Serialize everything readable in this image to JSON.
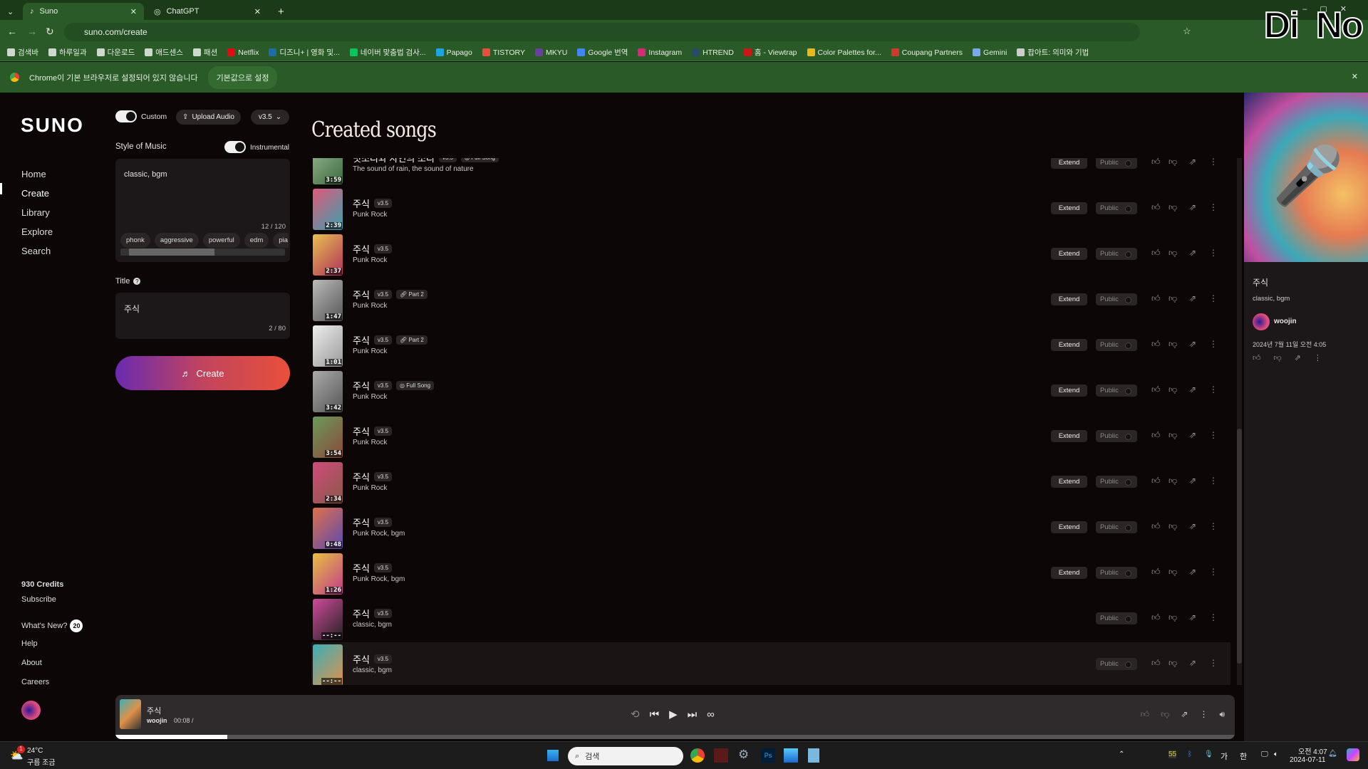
{
  "browser": {
    "tabs": [
      {
        "label": "Suno",
        "active": true
      },
      {
        "label": "ChatGPT",
        "active": false
      }
    ],
    "url": "suno.com/create",
    "bookmarks": [
      {
        "label": "검색바",
        "color": "#cfd8cc"
      },
      {
        "label": "하루일과",
        "color": "#cfd8cc"
      },
      {
        "label": "다운로드",
        "color": "#cfd8cc"
      },
      {
        "label": "애드센스",
        "color": "#cfd8cc"
      },
      {
        "label": "패션",
        "color": "#cfd8cc"
      },
      {
        "label": "Netflix",
        "color": "#e50914"
      },
      {
        "label": "디즈니+ | 영화 및...",
        "color": "#1e6ba8"
      },
      {
        "label": "네이버 맞춤법 검사...",
        "color": "#03c75a"
      },
      {
        "label": "Papago",
        "color": "#1fa4e0"
      },
      {
        "label": "TISTORY",
        "color": "#e84e3c"
      },
      {
        "label": "MKYU",
        "color": "#6a3fa0"
      },
      {
        "label": "Google 번역",
        "color": "#4285f4"
      },
      {
        "label": "Instagram",
        "color": "#d62976"
      },
      {
        "label": "HTREND",
        "color": "#2a4a6a"
      },
      {
        "label": "홈 - Viewtrap",
        "color": "#c81818"
      },
      {
        "label": "Color Palettes for...",
        "color": "#e8b820"
      },
      {
        "label": "Coupang Partners",
        "color": "#d03a2a"
      },
      {
        "label": "Gemini",
        "color": "#7aa8f0"
      },
      {
        "label": "팝아트: 의미와 기법",
        "color": "#cccccc"
      }
    ],
    "infobar": {
      "message": "Chrome이 기본 브라우저로 설정되어 있지 않습니다",
      "button": "기본값으로 설정"
    },
    "overlay_logo": "DiNo"
  },
  "nav": {
    "logo": "SUNO",
    "items": [
      {
        "label": "Home"
      },
      {
        "label": "Create",
        "active": true
      },
      {
        "label": "Library"
      },
      {
        "label": "Explore"
      },
      {
        "label": "Search"
      }
    ],
    "credits": "930 Credits",
    "subscribe": "Subscribe",
    "whats_new": "What's New?",
    "whats_new_count": "20",
    "help": "Help",
    "about": "About",
    "careers": "Careers"
  },
  "create": {
    "custom_label": "Custom",
    "custom_on": true,
    "upload_label": "Upload Audio",
    "version": "v3.5",
    "style_label": "Style of Music",
    "instrumental_label": "Instrumental",
    "instrumental_on": true,
    "style_value": "classic, bgm",
    "style_count": "12 / 120",
    "chips": [
      "phonk",
      "aggressive",
      "powerful",
      "edm",
      "pia"
    ],
    "title_label": "Title",
    "title_value": "주식",
    "title_count": "2 / 80",
    "create_button": "Create"
  },
  "songs": {
    "heading": "Created songs",
    "extend": "Extend",
    "public": "Public",
    "items": [
      {
        "title": "빗소리와 자연의 소리",
        "version": "v3.5",
        "tag": "Full Song",
        "style": "The sound of rain, the sound of nature",
        "duration": "3:59",
        "extend": true,
        "colors": [
          "#9ab890",
          "#3e6a40"
        ]
      },
      {
        "title": "주식",
        "version": "v3.5",
        "tag": "",
        "style": "Punk Rock",
        "duration": "2:39",
        "extend": true,
        "colors": [
          "#e05a7a",
          "#3aa0b0"
        ]
      },
      {
        "title": "주식",
        "version": "v3.5",
        "tag": "",
        "style": "Punk Rock",
        "duration": "2:37",
        "extend": true,
        "colors": [
          "#e8c050",
          "#b0305a"
        ]
      },
      {
        "title": "주식",
        "version": "v3.5",
        "tag": "Part 2",
        "style": "Punk Rock",
        "duration": "1:47",
        "extend": true,
        "colors": [
          "#bbbbbb",
          "#555555"
        ]
      },
      {
        "title": "주식",
        "version": "v3.5",
        "tag": "Part 2",
        "style": "Punk Rock",
        "duration": "1:01",
        "extend": true,
        "colors": [
          "#eeeeee",
          "#999999"
        ]
      },
      {
        "title": "주식",
        "version": "v3.5",
        "tag": "Full Song",
        "style": "Punk Rock",
        "duration": "3:42",
        "extend": true,
        "colors": [
          "#aaaaaa",
          "#555555"
        ]
      },
      {
        "title": "주식",
        "version": "v3.5",
        "tag": "",
        "style": "Punk Rock",
        "duration": "3:54",
        "extend": true,
        "colors": [
          "#6a9a5a",
          "#8a4a3a"
        ]
      },
      {
        "title": "주식",
        "version": "v3.5",
        "tag": "",
        "style": "Punk Rock",
        "duration": "2:34",
        "extend": true,
        "colors": [
          "#d04a7a",
          "#8a5a4a"
        ]
      },
      {
        "title": "주식",
        "version": "v3.5",
        "tag": "",
        "style": "Punk Rock, bgm",
        "duration": "0:48",
        "extend": true,
        "colors": [
          "#e0704a",
          "#5a4ab0"
        ]
      },
      {
        "title": "주식",
        "version": "v3.5",
        "tag": "",
        "style": "Punk Rock, bgm",
        "duration": "1:26",
        "extend": true,
        "colors": [
          "#e8c040",
          "#c03a8a"
        ]
      },
      {
        "title": "주식",
        "version": "v3.5",
        "tag": "",
        "style": "classic, bgm",
        "duration": "--:--",
        "extend": false,
        "colors": [
          "#d04a9a",
          "#222222"
        ]
      },
      {
        "title": "주식",
        "version": "v3.5",
        "tag": "",
        "style": "classic, bgm",
        "duration": "--:--",
        "extend": false,
        "selected": true,
        "colors": [
          "#3ab0b8",
          "#e0904a"
        ]
      }
    ]
  },
  "detail": {
    "title": "주식",
    "style": "classic, bgm",
    "user": "woojin",
    "date": "2024년 7월 11일 오전 4:05"
  },
  "player": {
    "title": "주식",
    "user": "woojin",
    "time": "00:08 /",
    "progress": 0.1
  },
  "taskbar": {
    "weather_temp": "24°C",
    "weather_desc": "구름 조금",
    "weather_badge": "1",
    "search_placeholder": "검색",
    "tray_55": "55",
    "ime1": "가",
    "ime2": "한",
    "time": "오전 4:07",
    "date": "2024-07-11"
  }
}
